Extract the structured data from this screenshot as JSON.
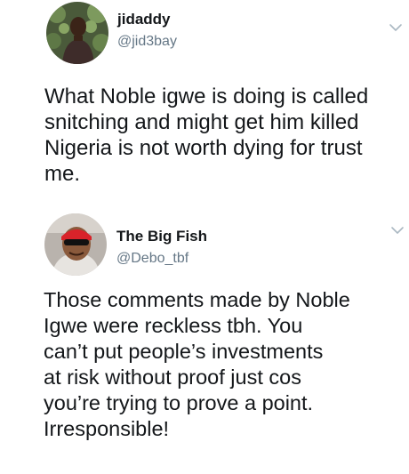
{
  "tweets": [
    {
      "display_name": "jidaddy",
      "handle": "@jid3bay",
      "avatar_icon": "user-photo-avatar",
      "menu_icon": "chevron-down-icon",
      "text_lines": [
        "What Noble igwe is doing is called",
        "snitching and might get him killed",
        "Nigeria is not worth dying for trust",
        "me."
      ]
    },
    {
      "display_name": "The Big Fish",
      "handle": "@Debo_tbf",
      "avatar_icon": "user-photo-avatar",
      "menu_icon": "chevron-down-icon",
      "text_lines": [
        "Those comments made by Noble",
        "Igwe were reckless tbh. You",
        "can’t put people’s investments",
        "at risk without proof just cos",
        "you’re trying to prove a point.",
        "Irresponsible!"
      ]
    }
  ],
  "colors": {
    "text": "#14171a",
    "secondary": "#657786",
    "chevron": "#aab8c2",
    "background": "#ffffff"
  }
}
